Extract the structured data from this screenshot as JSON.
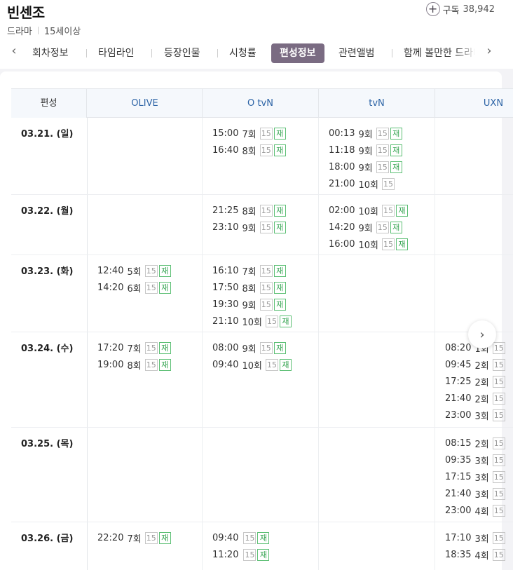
{
  "header": {
    "title": "빈센조",
    "subscribe_label": "구독",
    "subscribe_count": "38,942",
    "genre": "드라마",
    "age": "15세이상"
  },
  "tabs": [
    "회차정보",
    "타임라인",
    "등장인물",
    "시청률",
    "편성정보",
    "관련앨범",
    "함께 볼만한 드라마"
  ],
  "active_tab": "편성정보",
  "icons": {
    "subscribe": "plus-circle-icon",
    "tab_prev": "chevron-left-icon",
    "tab_next": "chevron-right-icon",
    "table_next": "chevron-right-icon"
  },
  "colors": {
    "active_tab_bg": "#7a6b82",
    "channel_header": "#2d64a6",
    "rerun_badge": "#32a34f"
  },
  "table": {
    "header_label": "편성",
    "channels": [
      "OLIVE",
      "O tvN",
      "tvN",
      "UXN"
    ],
    "rows": [
      {
        "date": "03.21. (일)",
        "cells": [
          [],
          [
            {
              "time": "15:00",
              "ep": "7회",
              "age": "15",
              "re": "재"
            },
            {
              "time": "16:40",
              "ep": "8회",
              "age": "15",
              "re": "재"
            }
          ],
          [
            {
              "time": "00:13",
              "ep": "9회",
              "age": "15",
              "re": "재"
            },
            {
              "time": "11:18",
              "ep": "9회",
              "age": "15",
              "re": "재"
            },
            {
              "time": "18:00",
              "ep": "9회",
              "age": "15",
              "re": "재"
            },
            {
              "time": "21:00",
              "ep": "10회",
              "age": "15",
              "re": ""
            }
          ],
          []
        ]
      },
      {
        "date": "03.22. (월)",
        "cells": [
          [],
          [
            {
              "time": "21:25",
              "ep": "8회",
              "age": "15",
              "re": "재"
            },
            {
              "time": "23:10",
              "ep": "9회",
              "age": "15",
              "re": "재"
            }
          ],
          [
            {
              "time": "02:00",
              "ep": "10회",
              "age": "15",
              "re": "재"
            },
            {
              "time": "14:20",
              "ep": "9회",
              "age": "15",
              "re": "재"
            },
            {
              "time": "16:00",
              "ep": "10회",
              "age": "15",
              "re": "재"
            }
          ],
          []
        ]
      },
      {
        "date": "03.23. (화)",
        "cells": [
          [
            {
              "time": "12:40",
              "ep": "5회",
              "age": "15",
              "re": "재"
            },
            {
              "time": "14:20",
              "ep": "6회",
              "age": "15",
              "re": "재"
            }
          ],
          [
            {
              "time": "16:10",
              "ep": "7회",
              "age": "15",
              "re": "재"
            },
            {
              "time": "17:50",
              "ep": "8회",
              "age": "15",
              "re": "재"
            },
            {
              "time": "19:30",
              "ep": "9회",
              "age": "15",
              "re": "재"
            },
            {
              "time": "21:10",
              "ep": "10회",
              "age": "15",
              "re": "재"
            }
          ],
          [],
          []
        ]
      },
      {
        "date": "03.24. (수)",
        "cells": [
          [
            {
              "time": "17:20",
              "ep": "7회",
              "age": "15",
              "re": "재"
            },
            {
              "time": "19:00",
              "ep": "8회",
              "age": "15",
              "re": "재"
            }
          ],
          [
            {
              "time": "08:00",
              "ep": "9회",
              "age": "15",
              "re": "재"
            },
            {
              "time": "09:40",
              "ep": "10회",
              "age": "15",
              "re": "재"
            }
          ],
          [],
          [
            {
              "time": "08:20",
              "ep": "1회",
              "age": "15",
              "re": ""
            },
            {
              "time": "09:45",
              "ep": "2회",
              "age": "15",
              "re": ""
            },
            {
              "time": "17:25",
              "ep": "2회",
              "age": "15",
              "re": ""
            },
            {
              "time": "21:40",
              "ep": "2회",
              "age": "15",
              "re": ""
            },
            {
              "time": "23:00",
              "ep": "3회",
              "age": "15",
              "re": ""
            }
          ]
        ]
      },
      {
        "date": "03.25. (목)",
        "cells": [
          [],
          [],
          [],
          [
            {
              "time": "08:15",
              "ep": "2회",
              "age": "15",
              "re": ""
            },
            {
              "time": "09:35",
              "ep": "3회",
              "age": "15",
              "re": ""
            },
            {
              "time": "17:15",
              "ep": "3회",
              "age": "15",
              "re": ""
            },
            {
              "time": "21:40",
              "ep": "3회",
              "age": "15",
              "re": ""
            },
            {
              "time": "23:00",
              "ep": "4회",
              "age": "15",
              "re": ""
            }
          ]
        ]
      },
      {
        "date": "03.26. (금)",
        "cells": [
          [
            {
              "time": "22:20",
              "ep": "7회",
              "age": "15",
              "re": "재"
            }
          ],
          [
            {
              "time": "09:40",
              "ep": "",
              "age": "15",
              "re": "재"
            },
            {
              "time": "11:20",
              "ep": "",
              "age": "15",
              "re": "재"
            }
          ],
          [],
          [
            {
              "time": "17:10",
              "ep": "3회",
              "age": "15",
              "re": ""
            },
            {
              "time": "18:35",
              "ep": "4회",
              "age": "15",
              "re": ""
            }
          ]
        ]
      }
    ]
  }
}
